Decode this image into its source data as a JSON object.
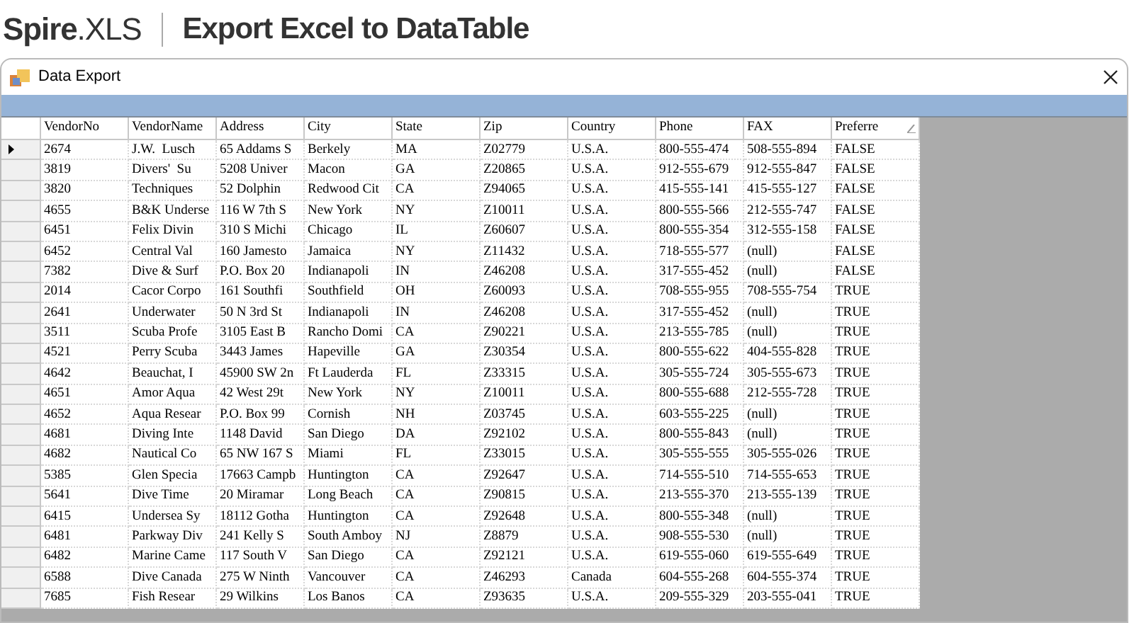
{
  "header": {
    "logo": "**Spire**.XLS",
    "title": "Export Excel to DataTable"
  },
  "window": {
    "title": "Data Export"
  },
  "grid": {
    "columns": [
      {
        "label": "VendorNo",
        "sorted": false
      },
      {
        "label": "VendorName",
        "sorted": false
      },
      {
        "label": "Address",
        "sorted": false
      },
      {
        "label": "City",
        "sorted": false
      },
      {
        "label": "State",
        "sorted": false
      },
      {
        "label": "Zip",
        "sorted": false
      },
      {
        "label": "Country",
        "sorted": false
      },
      {
        "label": "Phone",
        "sorted": false
      },
      {
        "label": "FAX",
        "sorted": false
      },
      {
        "label": "Preferre",
        "sorted": true
      }
    ],
    "rows": [
      {
        "current": true,
        "cells": [
          "2674",
          "J.W.  Lusch",
          "65 Addams S",
          "Berkely",
          "MA",
          "Z02779",
          "U.S.A.",
          "800-555-474",
          "508-555-894",
          "FALSE"
        ]
      },
      {
        "current": false,
        "cells": [
          "3819",
          "Divers'  Su",
          "5208 Univer",
          "Macon",
          "GA",
          "Z20865",
          "U.S.A.",
          "912-555-679",
          "912-555-847",
          "FALSE"
        ]
      },
      {
        "current": false,
        "cells": [
          "3820",
          "Techniques",
          "52 Dolphin",
          "Redwood Cit",
          "CA",
          "Z94065",
          "U.S.A.",
          "415-555-141",
          "415-555-127",
          "FALSE"
        ]
      },
      {
        "current": false,
        "cells": [
          "4655",
          "B&K Underse",
          "116 W 7th S",
          "New York",
          "NY",
          "Z10011",
          "U.S.A.",
          "800-555-566",
          "212-555-747",
          "FALSE"
        ]
      },
      {
        "current": false,
        "cells": [
          "6451",
          "Felix Divin",
          "310 S Michi",
          "Chicago",
          "IL",
          "Z60607",
          "U.S.A.",
          "800-555-354",
          "312-555-158",
          "FALSE"
        ]
      },
      {
        "current": false,
        "cells": [
          "6452",
          "Central Val",
          "160 Jamesto",
          "Jamaica",
          "NY",
          "Z11432",
          "U.S.A.",
          "718-555-577",
          "(null)",
          "FALSE"
        ]
      },
      {
        "current": false,
        "cells": [
          "7382",
          "Dive & Surf",
          "P.O. Box 20",
          "Indianapoli",
          "IN",
          "Z46208",
          "U.S.A.",
          "317-555-452",
          "(null)",
          "FALSE"
        ]
      },
      {
        "current": false,
        "cells": [
          "2014",
          "Cacor Corpo",
          "161 Southfi",
          "Southfield",
          "OH",
          "Z60093",
          "U.S.A.",
          "708-555-955",
          "708-555-754",
          "TRUE"
        ]
      },
      {
        "current": false,
        "cells": [
          "2641",
          "Underwater",
          "50 N 3rd St",
          "Indianapoli",
          "IN",
          "Z46208",
          "U.S.A.",
          "317-555-452",
          "(null)",
          "TRUE"
        ]
      },
      {
        "current": false,
        "cells": [
          "3511",
          "Scuba Profe",
          "3105 East B",
          "Rancho Domi",
          "CA",
          "Z90221",
          "U.S.A.",
          "213-555-785",
          "(null)",
          "TRUE"
        ]
      },
      {
        "current": false,
        "cells": [
          "4521",
          "Perry Scuba",
          "3443 James",
          "Hapeville",
          "GA",
          "Z30354",
          "U.S.A.",
          "800-555-622",
          "404-555-828",
          "TRUE"
        ]
      },
      {
        "current": false,
        "cells": [
          "4642",
          "Beauchat, I",
          "45900 SW 2n",
          "Ft Lauderda",
          "FL",
          "Z33315",
          "U.S.A.",
          "305-555-724",
          "305-555-673",
          "TRUE"
        ]
      },
      {
        "current": false,
        "cells": [
          "4651",
          "Amor Aqua",
          "42 West 29t",
          "New York",
          "NY",
          "Z10011",
          "U.S.A.",
          "800-555-688",
          "212-555-728",
          "TRUE"
        ]
      },
      {
        "current": false,
        "cells": [
          "4652",
          "Aqua Resear",
          "P.O. Box 99",
          "Cornish",
          "NH",
          "Z03745",
          "U.S.A.",
          "603-555-225",
          "(null)",
          "TRUE"
        ]
      },
      {
        "current": false,
        "cells": [
          "4681",
          "Diving Inte",
          "1148 David",
          "San Diego",
          "DA",
          "Z92102",
          "U.S.A.",
          "800-555-843",
          "(null)",
          "TRUE"
        ]
      },
      {
        "current": false,
        "cells": [
          "4682",
          "Nautical Co",
          "65 NW 167 S",
          "Miami",
          "FL",
          "Z33015",
          "U.S.A.",
          "305-555-555",
          "305-555-026",
          "TRUE"
        ]
      },
      {
        "current": false,
        "cells": [
          "5385",
          "Glen Specia",
          "17663 Campb",
          "Huntington",
          "CA",
          "Z92647",
          "U.S.A.",
          "714-555-510",
          "714-555-653",
          "TRUE"
        ]
      },
      {
        "current": false,
        "cells": [
          "5641",
          "Dive Time",
          "20 Miramar",
          "Long Beach",
          "CA",
          "Z90815",
          "U.S.A.",
          "213-555-370",
          "213-555-139",
          "TRUE"
        ]
      },
      {
        "current": false,
        "cells": [
          "6415",
          "Undersea Sy",
          "18112 Gotha",
          "Huntington",
          "CA",
          "Z92648",
          "U.S.A.",
          "800-555-348",
          "(null)",
          "TRUE"
        ]
      },
      {
        "current": false,
        "cells": [
          "6481",
          "Parkway Div",
          "241 Kelly S",
          "South Amboy",
          "NJ",
          "Z8879",
          "U.S.A.",
          "908-555-530",
          "(null)",
          "TRUE"
        ]
      },
      {
        "current": false,
        "cells": [
          "6482",
          "Marine Came",
          "117 South V",
          "San Diego",
          "CA",
          "Z92121",
          "U.S.A.",
          "619-555-060",
          "619-555-649",
          "TRUE"
        ]
      },
      {
        "current": false,
        "cells": [
          "6588",
          "Dive Canada",
          "275 W Ninth",
          "Vancouver",
          "CA",
          "Z46293",
          "Canada",
          "604-555-268",
          "604-555-374",
          "TRUE"
        ]
      },
      {
        "current": false,
        "cells": [
          "7685",
          "Fish Resear",
          "29 Wilkins",
          "Los Banos",
          "CA",
          "Z93635",
          "U.S.A.",
          "209-555-329",
          "203-555-041",
          "TRUE"
        ]
      }
    ]
  }
}
